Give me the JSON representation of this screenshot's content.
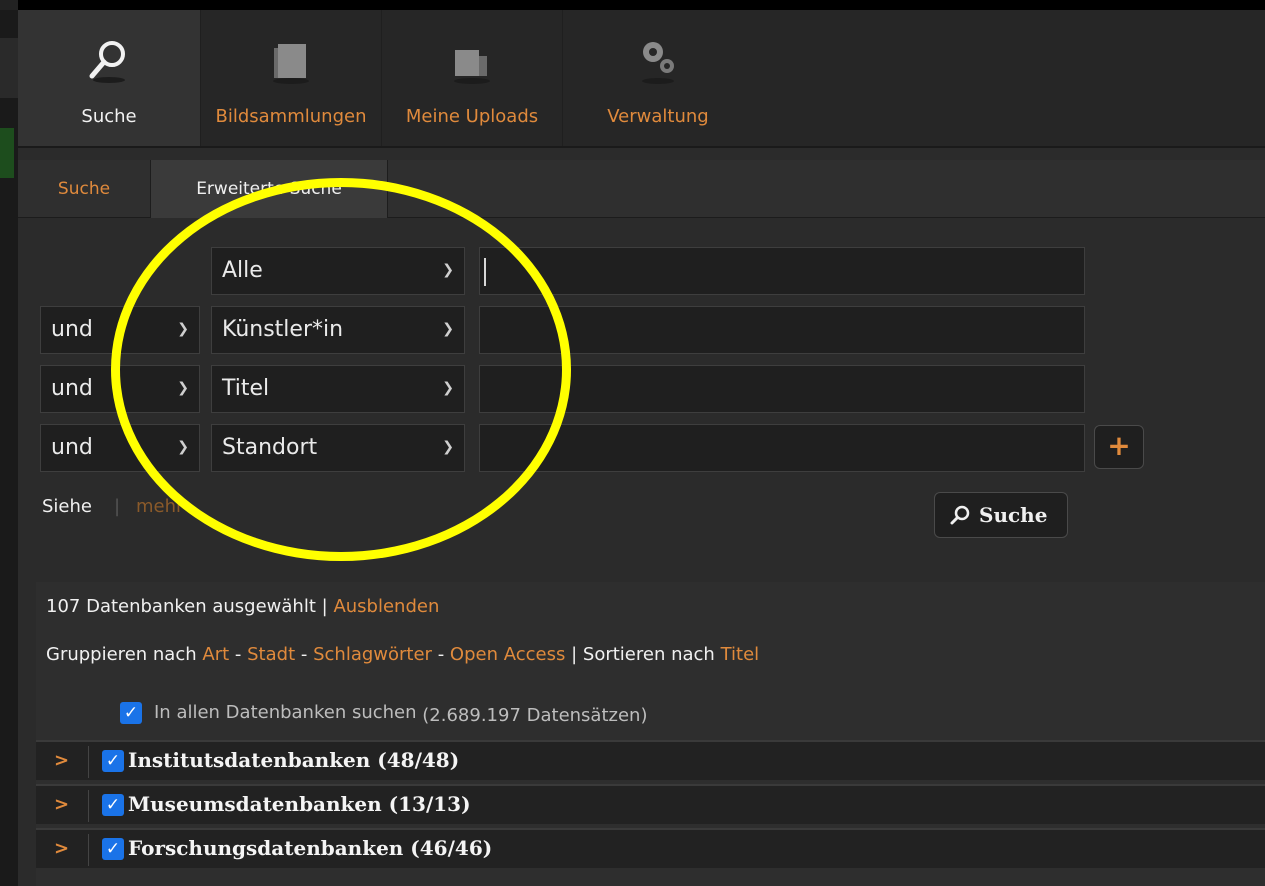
{
  "nav": {
    "items": [
      {
        "label": "Suche",
        "icon": "search-icon",
        "active": true
      },
      {
        "label": "Bildsammlungen",
        "icon": "folder-icon",
        "active": false
      },
      {
        "label": "Meine Uploads",
        "icon": "upload-icon",
        "active": false
      },
      {
        "label": "Verwaltung",
        "icon": "gears-icon",
        "active": false
      }
    ]
  },
  "subtabs": {
    "search": "Suche",
    "advanced": "Erweiterte Suche"
  },
  "form": {
    "rows": [
      {
        "operator": null,
        "field": "Alle",
        "value": ""
      },
      {
        "operator": "und",
        "field": "Künstler*in",
        "value": ""
      },
      {
        "operator": "und",
        "field": "Titel",
        "value": ""
      },
      {
        "operator": "und",
        "field": "Standort",
        "value": ""
      }
    ],
    "add_label": "+",
    "siehe": "Siehe",
    "siehe_more": "mehr",
    "separator": "|",
    "search_button": "Suche"
  },
  "databases": {
    "selected_text": "107 Datenbanken ausgewählt",
    "sep": "|",
    "hide_link": "Ausblenden",
    "group_prefix": "Gruppieren nach",
    "group_options": [
      "Art",
      "Stadt",
      "Schlagwörter",
      "Open Access"
    ],
    "dash": "-",
    "sort_prefix": "Sortieren nach",
    "sort_option": "Titel",
    "search_all_label": "In allen Datenbanken suchen",
    "search_all_count": "(2.689.197 Datensätzen)",
    "groups": [
      {
        "label": "Institutsdatenbanken (48/48)",
        "checked": true
      },
      {
        "label": "Museumsdatenbanken (13/13)",
        "checked": true
      },
      {
        "label": "Forschungsdatenbanken (46/46)",
        "checked": true
      }
    ],
    "expand_glyph": ">"
  },
  "colors": {
    "accent": "#e08a3c",
    "annotation": "#ffff00",
    "checkbox": "#1a73e8"
  }
}
